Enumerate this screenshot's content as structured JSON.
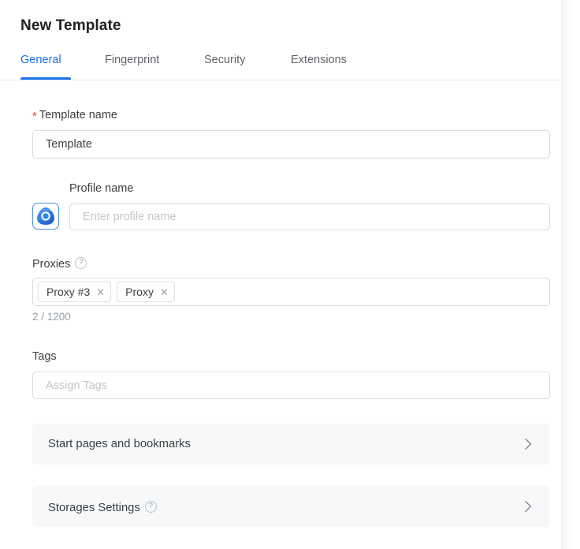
{
  "header": {
    "title": "New Template"
  },
  "tabs": [
    {
      "label": "General",
      "active": true
    },
    {
      "label": "Fingerprint",
      "active": false
    },
    {
      "label": "Security",
      "active": false
    },
    {
      "label": "Extensions",
      "active": false
    }
  ],
  "form": {
    "template_name": {
      "label": "Template name",
      "required_marker": "*",
      "value": "Template",
      "placeholder": "Template name"
    },
    "profile_name": {
      "label": "Profile name",
      "value": "",
      "placeholder": "Enter profile name",
      "icon": "browser-profile-logo-icon"
    },
    "proxies": {
      "label": "Proxies",
      "help_icon": "question-circle-icon",
      "chips": [
        {
          "label": "Proxy #3",
          "remove_icon": "close-icon"
        },
        {
          "label": "Proxy",
          "remove_icon": "close-icon"
        }
      ],
      "counter": "2 / 1200"
    },
    "tags": {
      "label": "Tags",
      "value": "",
      "placeholder": "Assign Tags"
    }
  },
  "sections": [
    {
      "label": "Start pages and bookmarks",
      "has_help": false,
      "help_icon": "",
      "chevron_icon": "chevron-right-icon"
    },
    {
      "label": "Storages Settings",
      "has_help": true,
      "help_icon": "question-circle-icon",
      "chevron_icon": "chevron-right-icon"
    }
  ],
  "colors": {
    "accent": "#1a73e8",
    "required": "#e8443a",
    "text": "#3c4043",
    "muted": "#9aa0a6",
    "border": "#dadce0",
    "section_bg": "#f7f8f9"
  }
}
